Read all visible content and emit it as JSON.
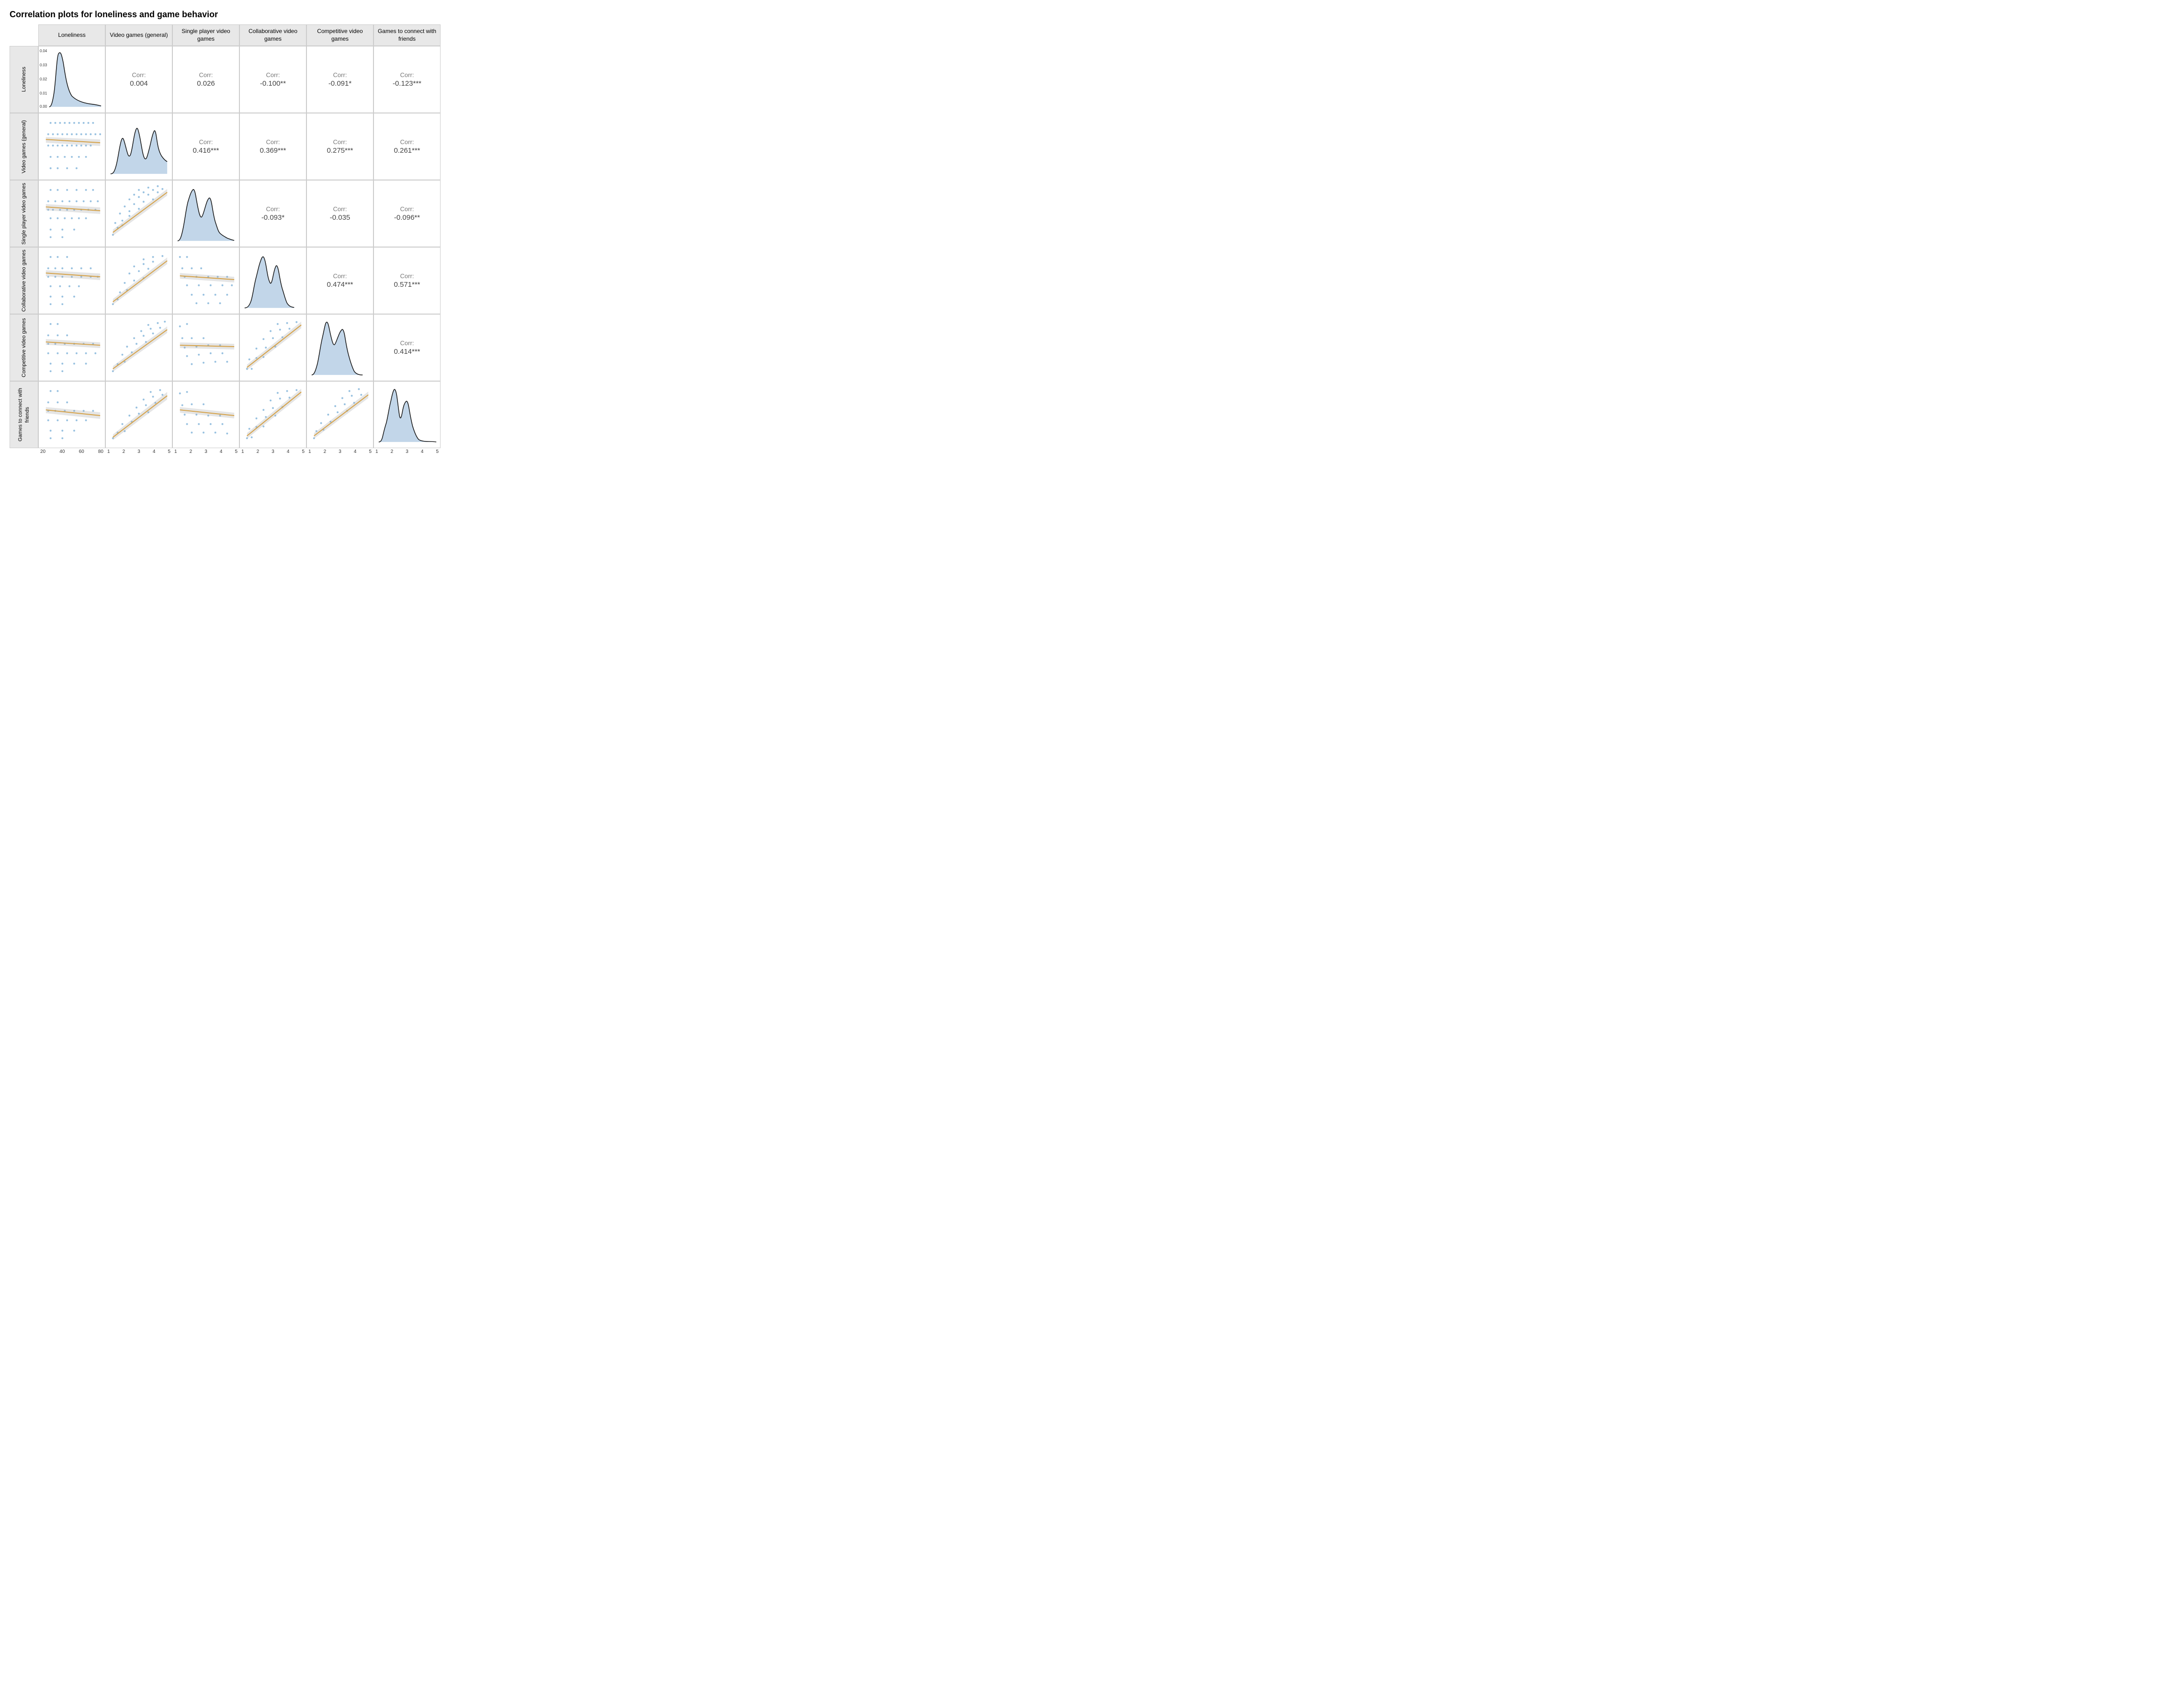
{
  "title": "Correlation plots for loneliness and game behavior",
  "col_headers": [
    "Loneliness",
    "Video games (general)",
    "Single player video games",
    "Collaborative video games",
    "Competitive video games",
    "Games to connect with friends"
  ],
  "row_labels": [
    "Loneliness",
    "Video games (general)",
    "Single player video games",
    "Collaborative video games",
    "Competitive video games",
    "Games to connect with friends"
  ],
  "correlations": {
    "r0c1": {
      "label": "Corr:",
      "value": "0.004"
    },
    "r0c2": {
      "label": "Corr:",
      "value": "0.026"
    },
    "r0c3": {
      "label": "Corr:",
      "value": "-0.100**"
    },
    "r0c4": {
      "label": "Corr:",
      "value": "-0.091*"
    },
    "r0c5": {
      "label": "Corr:",
      "value": "-0.123***"
    },
    "r1c2": {
      "label": "Corr:",
      "value": "0.416***"
    },
    "r1c3": {
      "label": "Corr:",
      "value": "0.369***"
    },
    "r1c4": {
      "label": "Corr:",
      "value": "0.275***"
    },
    "r1c5": {
      "label": "Corr:",
      "value": "0.261***"
    },
    "r2c3": {
      "label": "Corr:",
      "value": "-0.093*"
    },
    "r2c4": {
      "label": "Corr:",
      "value": "-0.035"
    },
    "r2c5": {
      "label": "Corr:",
      "value": "-0.096**"
    },
    "r3c4": {
      "label": "Corr:",
      "value": "0.474***"
    },
    "r3c5": {
      "label": "Corr:",
      "value": "0.571***"
    },
    "r4c5": {
      "label": "Corr:",
      "value": "0.414***"
    }
  },
  "x_axis_labels": {
    "loneliness": [
      "20",
      "40",
      "60",
      "80"
    ],
    "games": [
      "1",
      "2",
      "3",
      "4",
      "5"
    ]
  }
}
